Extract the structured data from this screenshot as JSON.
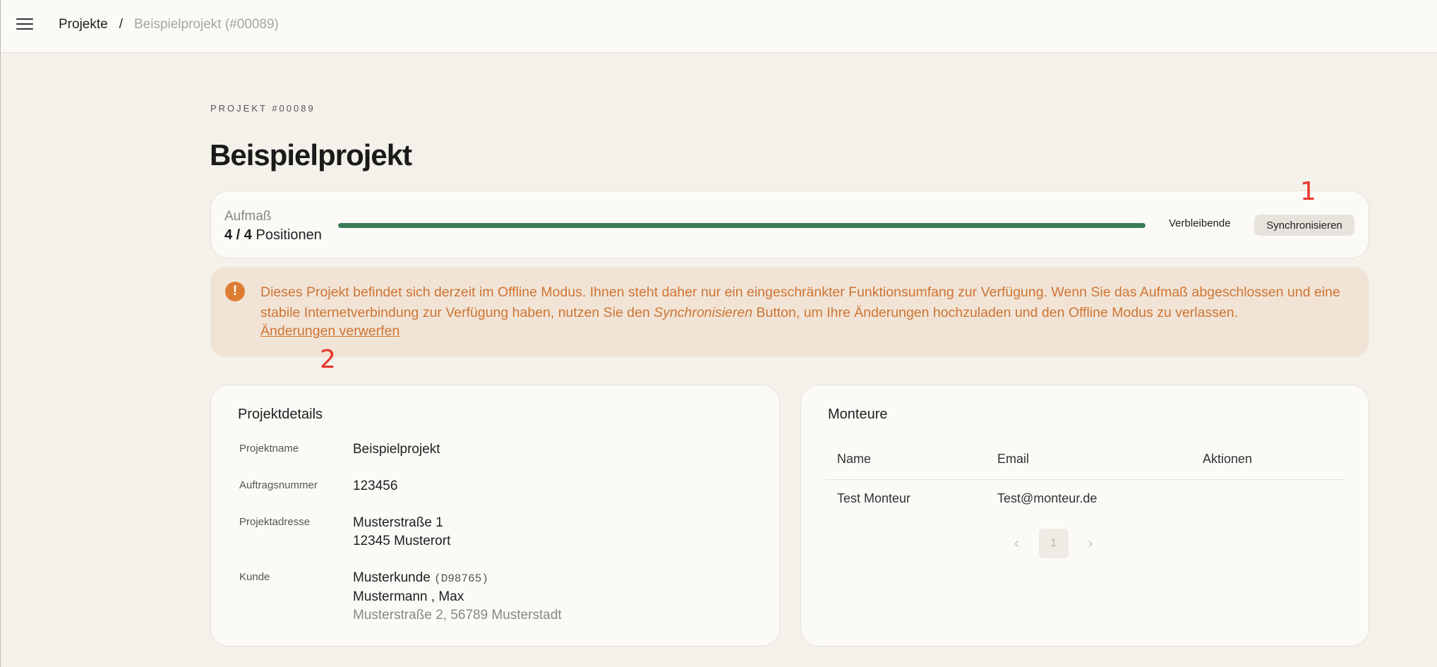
{
  "topbar": {
    "menu_icon": "hamburger-menu-icon",
    "breadcrumb": {
      "root": "Projekte",
      "separator": "/",
      "current": "Beispielprojekt (#00089)"
    }
  },
  "header": {
    "eyebrow": "PROJEKT #00089",
    "title": "Beispielprojekt"
  },
  "progress": {
    "label": "Aufmaß",
    "done": "4 / 4",
    "unit": "Positionen",
    "fraction": 1.0,
    "bar_color": "#3b7a57",
    "remaining_button": "Verbleibende",
    "sync_button": "Synchronisieren"
  },
  "markers": {
    "one": "1",
    "two": "2",
    "color": "#e8372c"
  },
  "alert": {
    "icon": "exclamation-circle-icon",
    "text_before": "Dieses Projekt befindet sich derzeit im Offline Modus. Ihnen steht daher nur ein eingeschränkter Funktionsumfang zur Verfügung. Wenn Sie das Aufmaß abgeschlossen und eine stabile Internetverbindung zur Verfügung haben, nutzen Sie den ",
    "text_emph": "Synchronisieren",
    "text_after": " Button, um Ihre Änderungen hochzuladen und den Offline Modus zu verlassen.",
    "link": "Änderungen verwerfen",
    "color": "#cf7433"
  },
  "details": {
    "title": "Projektdetails",
    "project_name": {
      "key": "Projektname",
      "value": "Beispielprojekt"
    },
    "order_number": {
      "key": "Auftragsnummer",
      "value": "123456"
    },
    "address": {
      "key": "Projektadresse",
      "line1": "Musterstraße 1",
      "line2": "12345 Musterort"
    },
    "customer": {
      "key": "Kunde",
      "name": "Musterkunde",
      "code": "(D98765)",
      "contact": "Mustermann , Max",
      "address": "Musterstraße 2, 56789 Musterstadt"
    }
  },
  "team": {
    "title": "Monteure",
    "columns": [
      "Name",
      "Email",
      "Aktionen"
    ],
    "rows": [
      {
        "name": "Test Monteur",
        "email": "Test@monteur.de",
        "actions": ""
      }
    ],
    "pager": {
      "prev_icon": "chevron-left-icon",
      "page": "1",
      "next_icon": "chevron-right-icon"
    }
  }
}
